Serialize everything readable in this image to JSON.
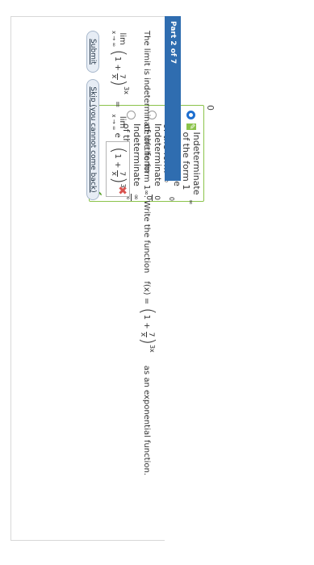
{
  "part1": {
    "top_text": "0",
    "options": [
      {
        "prefix": "Indeterminate of the form 1",
        "sup": "∞",
        "selected": true,
        "marked": true
      },
      {
        "prefix": "Indeterminate of the form ∞",
        "sup": "0",
        "selected": false,
        "marked": false
      },
      {
        "prefix": "Indeterminate of the form",
        "frac_num": "0",
        "frac_den": "0",
        "selected": false,
        "marked": false
      },
      {
        "prefix": "Indeterminate of the form",
        "frac_num": "∞",
        "frac_den": "∞",
        "selected": false,
        "marked": false
      }
    ]
  },
  "part2": {
    "header": "Part 2 of 7",
    "statement": {
      "lead": "The limit is indeterminate of the form 1",
      "lead_sup": "∞",
      "mid": ". Write the function",
      "fx": "f(x) =",
      "paren_inner_1": "1 +",
      "frac_num": "7",
      "frac_den": "x",
      "exp": "3x",
      "tail": "as an exponential function."
    },
    "equation": {
      "lim": "lim",
      "lim_sub": "x → ∞",
      "inner_1": "1 +",
      "frac_num": "7",
      "frac_den": "x",
      "exp": "3x",
      "equals": "=",
      "lim2": "lim",
      "lim2_sub": "x → ∞",
      "base": "e",
      "answer_inner": "1 +",
      "answer_frac_num": "7",
      "answer_frac_den": "x",
      "answer_exp": "3x"
    },
    "buttons": {
      "submit": "Submit",
      "skip": "Skip (you cannot come back)"
    }
  }
}
